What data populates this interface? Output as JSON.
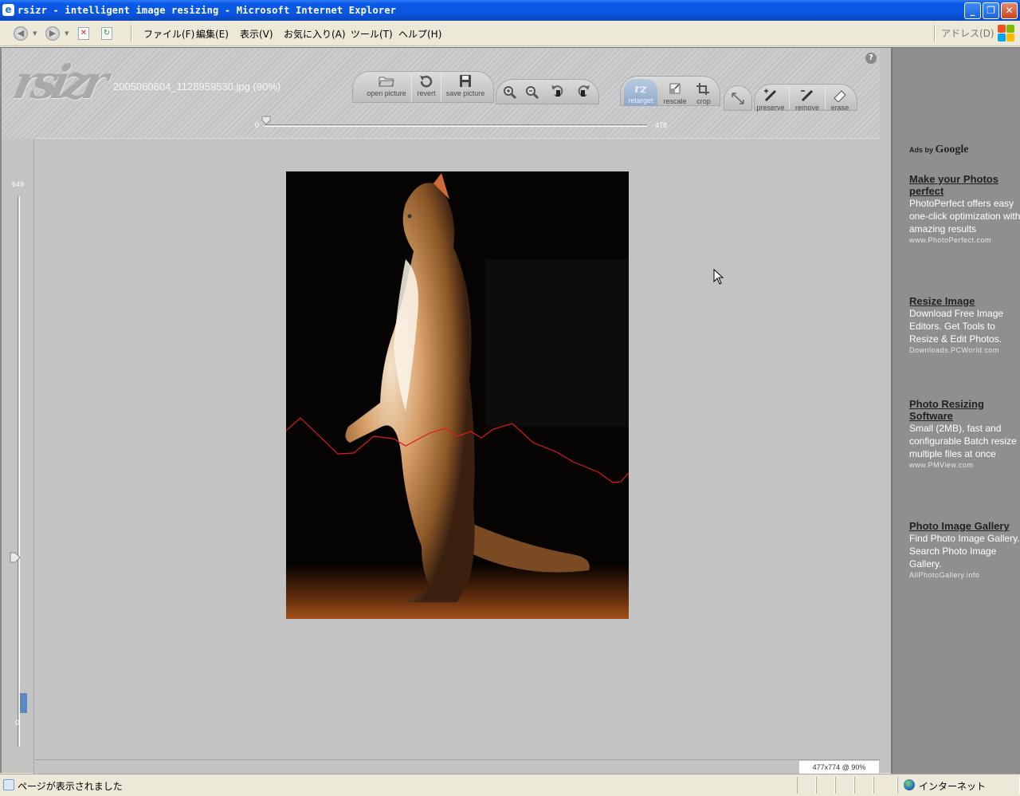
{
  "window": {
    "title": "rsizr - intelligent image resizing - Microsoft Internet Explorer",
    "icon": "ie-icon",
    "controls": {
      "minimize": "_",
      "restore": "❐",
      "close": "✕"
    }
  },
  "menubar": {
    "items": [
      "ファイル(F)",
      "編集(E)",
      "表示(V)",
      "お気に入り(A)",
      "ツール(T)",
      "ヘルプ(H)"
    ],
    "address_label": "アドレス(D)"
  },
  "app": {
    "logo": "rsizr",
    "filename": "2005060604_1128959530.jpg (90%)",
    "help": "?",
    "file_tools": [
      {
        "label": "open picture",
        "icon": "open-folder-icon"
      },
      {
        "label": "revert",
        "icon": "revert-icon"
      },
      {
        "label": "save picture",
        "icon": "save-disk-icon"
      }
    ],
    "view_tools": [
      {
        "icon": "zoom-in-icon"
      },
      {
        "icon": "zoom-out-icon"
      },
      {
        "icon": "rotate-left-icon"
      },
      {
        "icon": "rotate-right-icon"
      }
    ],
    "mode_tools": [
      {
        "label": "retarget",
        "icon": "retarget-icon",
        "active": true
      },
      {
        "label": "rescale",
        "icon": "rescale-icon"
      },
      {
        "label": "crop",
        "icon": "crop-icon"
      }
    ],
    "expand_icon": "expand-arrows-icon",
    "brush_tools": [
      {
        "label": "preserve",
        "icon": "preserve-brush-icon"
      },
      {
        "label": "remove",
        "icon": "remove-brush-icon"
      },
      {
        "label": "erase",
        "icon": "eraser-icon"
      }
    ],
    "width_slider": {
      "min": "0",
      "max": "478",
      "value": 0
    },
    "height_slider": {
      "max": "649",
      "min": "0",
      "value": 0.04
    },
    "readout": "477x774 @ 90%"
  },
  "ads": {
    "header_prefix": "Ads by",
    "header_brand": "Google",
    "items": [
      {
        "title": "Make your Photos perfect",
        "body": "PhotoPerfect offers easy one-click optimization with amazing results",
        "url": "www.PhotoPerfect.com"
      },
      {
        "title": "Resize Image",
        "body": "Download Free Image Editors. Get Tools to Resize & Edit Photos.",
        "url": "Downloads.PCWorld.com"
      },
      {
        "title": "Photo Resizing Software",
        "body": "Small (2MB), fast and configurable Batch resize multiple files at once",
        "url": "www.PMView.com"
      },
      {
        "title": "Photo Image Gallery",
        "body": "Find Photo Image Gallery. Search Photo Image Gallery.",
        "url": "AllPhotoGallery.info"
      }
    ]
  },
  "statusbar": {
    "text": "ページが表示されました",
    "zone": "インターネット"
  },
  "colors": {
    "xp_blue": "#0a5ae8",
    "seam_line": "#e0191c",
    "slider_fill": "#5a88c0"
  }
}
